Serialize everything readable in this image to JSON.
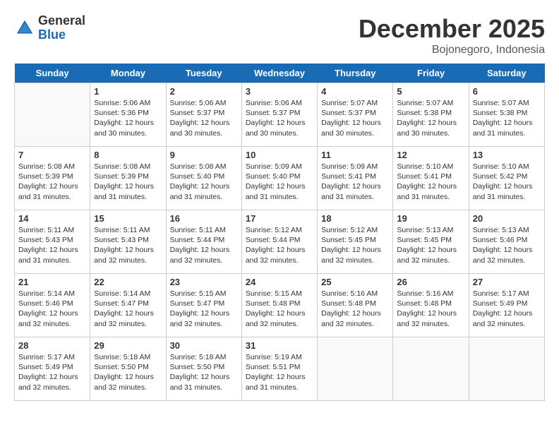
{
  "logo": {
    "general": "General",
    "blue": "Blue"
  },
  "title": "December 2025",
  "subtitle": "Bojonegoro, Indonesia",
  "headers": [
    "Sunday",
    "Monday",
    "Tuesday",
    "Wednesday",
    "Thursday",
    "Friday",
    "Saturday"
  ],
  "weeks": [
    [
      {
        "day": "",
        "sunrise": "",
        "sunset": "",
        "daylight": ""
      },
      {
        "day": "1",
        "sunrise": "5:06 AM",
        "sunset": "5:36 PM",
        "daylight": "12 hours and 30 minutes."
      },
      {
        "day": "2",
        "sunrise": "5:06 AM",
        "sunset": "5:37 PM",
        "daylight": "12 hours and 30 minutes."
      },
      {
        "day": "3",
        "sunrise": "5:06 AM",
        "sunset": "5:37 PM",
        "daylight": "12 hours and 30 minutes."
      },
      {
        "day": "4",
        "sunrise": "5:07 AM",
        "sunset": "5:37 PM",
        "daylight": "12 hours and 30 minutes."
      },
      {
        "day": "5",
        "sunrise": "5:07 AM",
        "sunset": "5:38 PM",
        "daylight": "12 hours and 30 minutes."
      },
      {
        "day": "6",
        "sunrise": "5:07 AM",
        "sunset": "5:38 PM",
        "daylight": "12 hours and 31 minutes."
      }
    ],
    [
      {
        "day": "7",
        "sunrise": "5:08 AM",
        "sunset": "5:39 PM",
        "daylight": "12 hours and 31 minutes."
      },
      {
        "day": "8",
        "sunrise": "5:08 AM",
        "sunset": "5:39 PM",
        "daylight": "12 hours and 31 minutes."
      },
      {
        "day": "9",
        "sunrise": "5:08 AM",
        "sunset": "5:40 PM",
        "daylight": "12 hours and 31 minutes."
      },
      {
        "day": "10",
        "sunrise": "5:09 AM",
        "sunset": "5:40 PM",
        "daylight": "12 hours and 31 minutes."
      },
      {
        "day": "11",
        "sunrise": "5:09 AM",
        "sunset": "5:41 PM",
        "daylight": "12 hours and 31 minutes."
      },
      {
        "day": "12",
        "sunrise": "5:10 AM",
        "sunset": "5:41 PM",
        "daylight": "12 hours and 31 minutes."
      },
      {
        "day": "13",
        "sunrise": "5:10 AM",
        "sunset": "5:42 PM",
        "daylight": "12 hours and 31 minutes."
      }
    ],
    [
      {
        "day": "14",
        "sunrise": "5:11 AM",
        "sunset": "5:43 PM",
        "daylight": "12 hours and 31 minutes."
      },
      {
        "day": "15",
        "sunrise": "5:11 AM",
        "sunset": "5:43 PM",
        "daylight": "12 hours and 32 minutes."
      },
      {
        "day": "16",
        "sunrise": "5:11 AM",
        "sunset": "5:44 PM",
        "daylight": "12 hours and 32 minutes."
      },
      {
        "day": "17",
        "sunrise": "5:12 AM",
        "sunset": "5:44 PM",
        "daylight": "12 hours and 32 minutes."
      },
      {
        "day": "18",
        "sunrise": "5:12 AM",
        "sunset": "5:45 PM",
        "daylight": "12 hours and 32 minutes."
      },
      {
        "day": "19",
        "sunrise": "5:13 AM",
        "sunset": "5:45 PM",
        "daylight": "12 hours and 32 minutes."
      },
      {
        "day": "20",
        "sunrise": "5:13 AM",
        "sunset": "5:46 PM",
        "daylight": "12 hours and 32 minutes."
      }
    ],
    [
      {
        "day": "21",
        "sunrise": "5:14 AM",
        "sunset": "5:46 PM",
        "daylight": "12 hours and 32 minutes."
      },
      {
        "day": "22",
        "sunrise": "5:14 AM",
        "sunset": "5:47 PM",
        "daylight": "12 hours and 32 minutes."
      },
      {
        "day": "23",
        "sunrise": "5:15 AM",
        "sunset": "5:47 PM",
        "daylight": "12 hours and 32 minutes."
      },
      {
        "day": "24",
        "sunrise": "5:15 AM",
        "sunset": "5:48 PM",
        "daylight": "12 hours and 32 minutes."
      },
      {
        "day": "25",
        "sunrise": "5:16 AM",
        "sunset": "5:48 PM",
        "daylight": "12 hours and 32 minutes."
      },
      {
        "day": "26",
        "sunrise": "5:16 AM",
        "sunset": "5:48 PM",
        "daylight": "12 hours and 32 minutes."
      },
      {
        "day": "27",
        "sunrise": "5:17 AM",
        "sunset": "5:49 PM",
        "daylight": "12 hours and 32 minutes."
      }
    ],
    [
      {
        "day": "28",
        "sunrise": "5:17 AM",
        "sunset": "5:49 PM",
        "daylight": "12 hours and 32 minutes."
      },
      {
        "day": "29",
        "sunrise": "5:18 AM",
        "sunset": "5:50 PM",
        "daylight": "12 hours and 32 minutes."
      },
      {
        "day": "30",
        "sunrise": "5:18 AM",
        "sunset": "5:50 PM",
        "daylight": "12 hours and 31 minutes."
      },
      {
        "day": "31",
        "sunrise": "5:19 AM",
        "sunset": "5:51 PM",
        "daylight": "12 hours and 31 minutes."
      },
      {
        "day": "",
        "sunrise": "",
        "sunset": "",
        "daylight": ""
      },
      {
        "day": "",
        "sunrise": "",
        "sunset": "",
        "daylight": ""
      },
      {
        "day": "",
        "sunrise": "",
        "sunset": "",
        "daylight": ""
      }
    ]
  ],
  "labels": {
    "sunrise": "Sunrise:",
    "sunset": "Sunset:",
    "daylight": "Daylight: 12 hours"
  }
}
